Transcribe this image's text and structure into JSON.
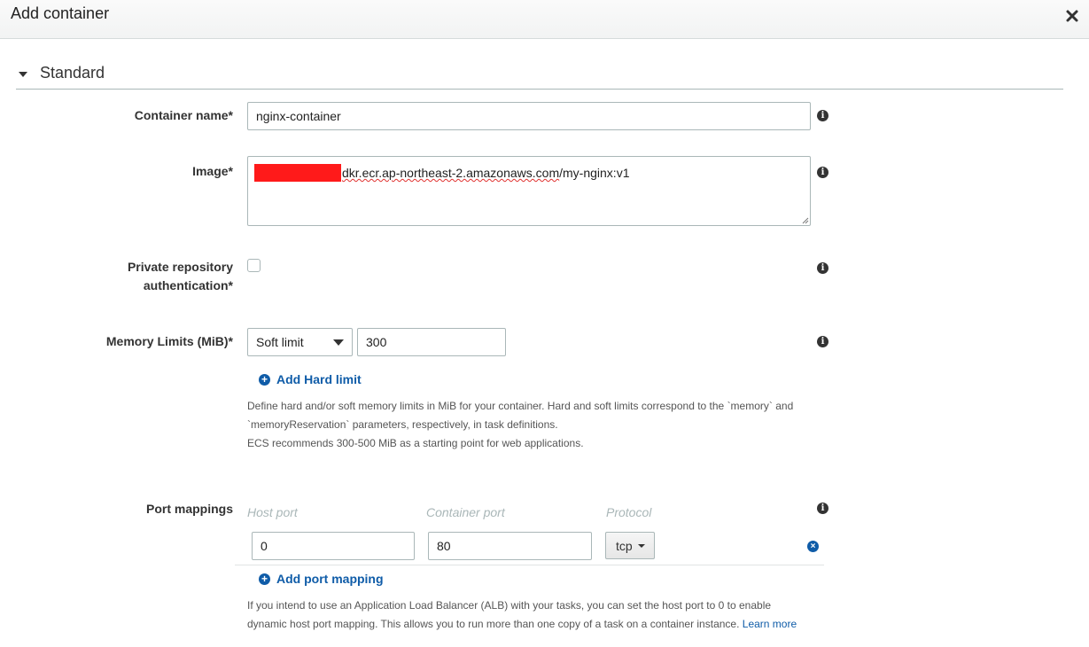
{
  "dialog": {
    "title": "Add container",
    "close_label": "×"
  },
  "section": {
    "title": "Standard"
  },
  "container_name": {
    "label": "Container name*",
    "value": "nginx-container"
  },
  "image": {
    "label": "Image*",
    "value_visible": "dkr.ecr.ap-northeast-2.amazonaws.com/my-nginx:v1",
    "value_part1": "dkr.ecr.ap-northeast-2.amazonaws.com",
    "value_part2": "/my-nginx:v1",
    "redaction_color": "#ff1a1a"
  },
  "private_repo": {
    "label_line1": "Private repository",
    "label_line2": "authentication*",
    "checked": false
  },
  "memory": {
    "label": "Memory Limits (MiB)*",
    "limit_type": "Soft limit",
    "value": "300",
    "add_hard_limit": "Add Hard limit",
    "help_line1": "Define hard and/or soft memory limits in MiB for your container. Hard and soft limits correspond to the `memory` and",
    "help_line2": "`memoryReservation` parameters, respectively, in task definitions.",
    "help_line3": "ECS recommends 300-500 MiB as a starting point for web applications."
  },
  "port_mappings": {
    "label": "Port mappings",
    "col_host": "Host port",
    "col_container": "Container port",
    "col_protocol": "Protocol",
    "rows": [
      {
        "host_port": "0",
        "container_port": "80",
        "protocol": "tcp"
      }
    ],
    "add_label": "Add port mapping",
    "help_line1": "If you intend to use an Application Load Balancer (ALB) with your tasks, you can set the host port to 0 to enable",
    "help_line2": "dynamic host port mapping. This allows you to run more than one copy of a task on a container instance.",
    "learn_more": "Learn more"
  },
  "icons": {
    "info": "info-icon",
    "plus": "plus-circle-icon",
    "remove": "remove-circle-icon",
    "close": "close-icon"
  },
  "colors": {
    "link": "#0f5ca8",
    "label": "#333333",
    "placeholder": "#aab7b8"
  }
}
